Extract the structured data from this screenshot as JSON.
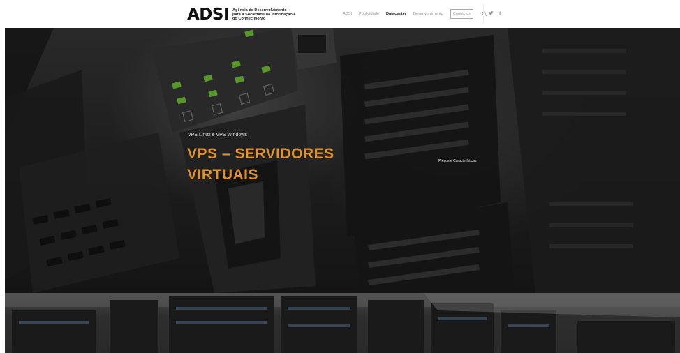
{
  "header": {
    "logo_mark": "ADSI",
    "logo_lines": [
      "Agência de Desenvolvimento",
      "para a Sociedade da Informação e",
      "do Conhecimento"
    ],
    "nav": [
      {
        "label": "ADSI",
        "active": false,
        "boxed": false
      },
      {
        "label": "Publicidade",
        "active": false,
        "boxed": false
      },
      {
        "label": "Datacenter",
        "active": true,
        "boxed": false
      },
      {
        "label": "Desenvolvimento",
        "active": false,
        "boxed": false
      },
      {
        "label": "Contactos",
        "active": false,
        "boxed": true
      }
    ],
    "search_icon": "search-icon",
    "social": {
      "twitter": "𝙬",
      "facebook": "f"
    }
  },
  "hero": {
    "subtitle": "VPS Linux e VPS Windows",
    "title": "VPS – SERVIDORES VIRTUAIS",
    "link": "Preços e Características"
  },
  "colors": {
    "accent": "#e0922c",
    "led_green": "#7bd23a"
  }
}
